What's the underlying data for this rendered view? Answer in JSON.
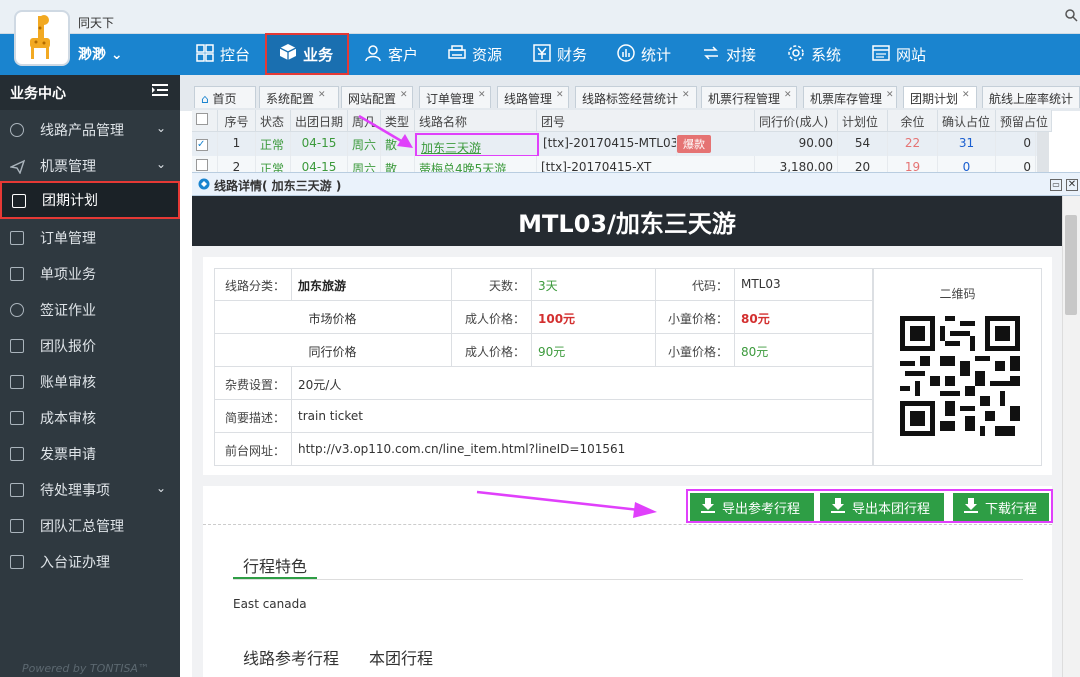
{
  "app": {
    "title": "同天下",
    "user": "渺渺"
  },
  "nav": [
    {
      "label": "控台",
      "icon": "dashboard-icon"
    },
    {
      "label": "业务",
      "icon": "cube-icon"
    },
    {
      "label": "客户",
      "icon": "user-icon"
    },
    {
      "label": "资源",
      "icon": "printer-icon"
    },
    {
      "label": "财务",
      "icon": "yen-icon"
    },
    {
      "label": "统计",
      "icon": "chart-icon"
    },
    {
      "label": "对接",
      "icon": "exchange-icon"
    },
    {
      "label": "系统",
      "icon": "gear-icon"
    },
    {
      "label": "网站",
      "icon": "web-icon"
    }
  ],
  "sidebar": {
    "header": "业务中心",
    "items": [
      {
        "label": "线路产品管理"
      },
      {
        "label": "机票管理"
      },
      {
        "label": "团期计划"
      },
      {
        "label": "订单管理"
      },
      {
        "label": "单项业务"
      },
      {
        "label": "签证作业"
      },
      {
        "label": "团队报价"
      },
      {
        "label": "账单审核"
      },
      {
        "label": "成本审核"
      },
      {
        "label": "发票申请"
      },
      {
        "label": "待处理事项"
      },
      {
        "label": "团队汇总管理"
      },
      {
        "label": "入台证办理"
      }
    ],
    "powered": "Powered by TONTISA™"
  },
  "tabs": [
    "首页",
    "系统配置",
    "网站配置",
    "订单管理",
    "线路管理",
    "线路标签经营统计",
    "机票行程管理",
    "机票库存管理",
    "团期计划",
    "航线上座率统计"
  ],
  "grid": {
    "headers": [
      "序号",
      "状态",
      "出团日期",
      "周几",
      "类型",
      "线路名称",
      "团号",
      "同行价(成人)",
      "计划位",
      "余位",
      "确认占位",
      "预留占位"
    ],
    "rows": [
      {
        "no": "1",
        "status": "正常",
        "date": "04-15",
        "weekday": "周六",
        "type": "散",
        "name": "加东三天游",
        "code": "[ttx]-20170415-MTL03",
        "badge": "爆款",
        "price": "90.00",
        "plan": "54",
        "remain": "22",
        "confirm": "31",
        "reserve": "0"
      },
      {
        "no": "2",
        "status": "正常",
        "date": "04-15",
        "weekday": "周六",
        "type": "散",
        "name": "蒂梅总4晚5天游",
        "code": "[ttx]-20170415-XT",
        "badge": "",
        "price": "3,180.00",
        "plan": "20",
        "remain": "19",
        "confirm": "0",
        "reserve": "0"
      }
    ]
  },
  "detail": {
    "window_title": "线路详情( 加东三天游 )",
    "heading": "MTL03/加东三天游",
    "labels": {
      "category": "线路分类：",
      "days": "天数：",
      "code": "代码：",
      "market_price": "市场价格",
      "peer_price": "同行价格",
      "adult": "成人价格：",
      "child": "小童价格：",
      "misc": "杂费设置：",
      "desc": "简要描述：",
      "url": "前台网址："
    },
    "values": {
      "category": "加东旅游",
      "days": "3天",
      "code": "MTL03",
      "market_adult": "100元",
      "market_child": "80元",
      "peer_adult": "90元",
      "peer_child": "80元",
      "misc": "20元/人",
      "desc": "train ticket",
      "url": "http://v3.op110.com.cn/line_item.html?lineID=101561"
    },
    "qr_label": "二维码",
    "buttons": [
      "导出参考行程",
      "导出本团行程",
      "下载行程"
    ],
    "section_title": "行程特色",
    "section_text": "East canada",
    "subtabs": [
      "线路参考行程",
      "本团行程"
    ]
  },
  "colors": {
    "nav_bg": "#1a84cf",
    "sidebar_bg": "#2f3940",
    "green_btn": "#2e9e45",
    "highlight": "#e040fb",
    "alert_red": "#e53935"
  }
}
